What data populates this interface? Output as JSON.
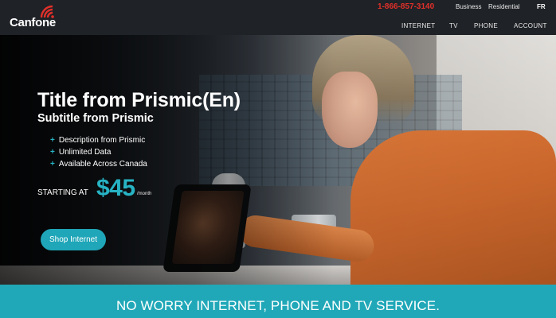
{
  "brand": {
    "name": "Canfone",
    "accent": "#e0302a",
    "teal": "#27b3c4"
  },
  "top_bar": {
    "phone": "1-866-857-3140",
    "links": [
      "Business",
      "Residential"
    ],
    "language": "FR"
  },
  "nav": {
    "items": [
      "INTERNET",
      "TV",
      "PHONE",
      "ACCOUNT"
    ]
  },
  "hero": {
    "title": "Title from Prismic(En)",
    "subtitle": "Subtitle from Prismic",
    "features": [
      {
        "bullet": "+",
        "text": "Description from Prismic"
      },
      {
        "bullet": "+",
        "text": "Unlimited Data"
      },
      {
        "bullet": "+",
        "text": "Available Across Canada"
      }
    ],
    "starting_label": "STARTING AT",
    "price": "$45",
    "price_unit": "/month",
    "cta_label": "Shop Internet"
  },
  "banner": {
    "text": "NO WORRY INTERNET, PHONE AND TV SERVICE."
  }
}
